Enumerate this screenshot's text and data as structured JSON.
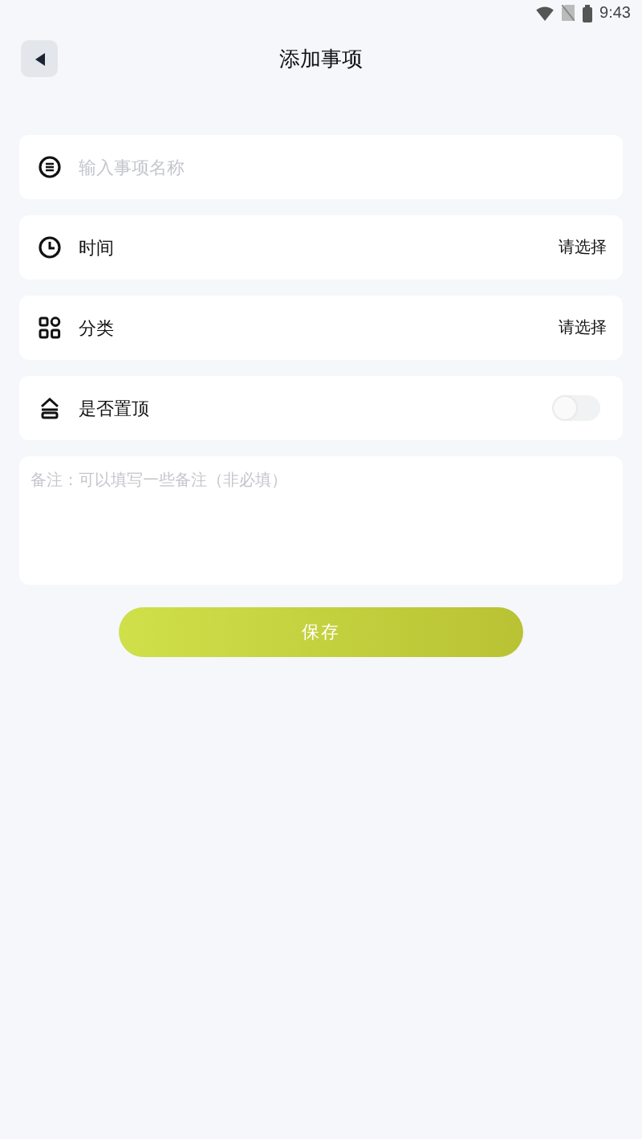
{
  "status_bar": {
    "time": "9:43"
  },
  "header": {
    "title": "添加事项"
  },
  "rows": [
    {
      "kind": "input",
      "placeholder": "输入事项名称"
    },
    {
      "kind": "select",
      "label": "时间",
      "value": "请选择"
    },
    {
      "kind": "select",
      "label": "分类",
      "value": "请选择"
    },
    {
      "kind": "toggle",
      "label": "是否置顶",
      "on": false
    }
  ],
  "notes": {
    "placeholder": "备注：可以填写一些备注（非必填）"
  },
  "save_button": {
    "label": "保存"
  }
}
